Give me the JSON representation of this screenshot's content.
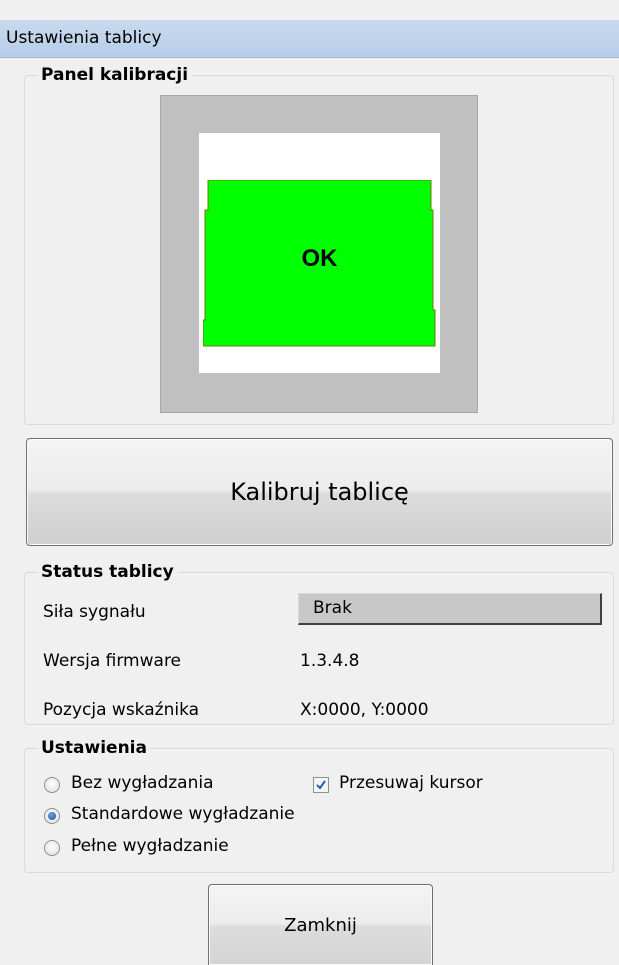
{
  "window": {
    "title": "Ustawienia tablicy"
  },
  "calibration": {
    "legend": "Panel kalibracji",
    "status_text": "OK",
    "status_color": "#00ff00",
    "button_label": "Kalibruj tablicę"
  },
  "status": {
    "legend": "Status tablicy",
    "rows": [
      {
        "label": "Siła sygnału",
        "value": "Brak"
      },
      {
        "label": "Wersja firmware",
        "value": "1.3.4.8"
      },
      {
        "label": "Pozycja wskaźnika",
        "value": "X:0000, Y:0000"
      }
    ]
  },
  "settings": {
    "legend": "Ustawienia",
    "smoothing_options": [
      {
        "label": "Bez wygładzania",
        "selected": false
      },
      {
        "label": "Standardowe wygładzanie",
        "selected": true
      },
      {
        "label": "Pełne wygładzanie",
        "selected": false
      }
    ],
    "move_cursor": {
      "label": "Przesuwaj kursor",
      "checked": true
    }
  },
  "footer": {
    "close_label": "Zamknij"
  }
}
